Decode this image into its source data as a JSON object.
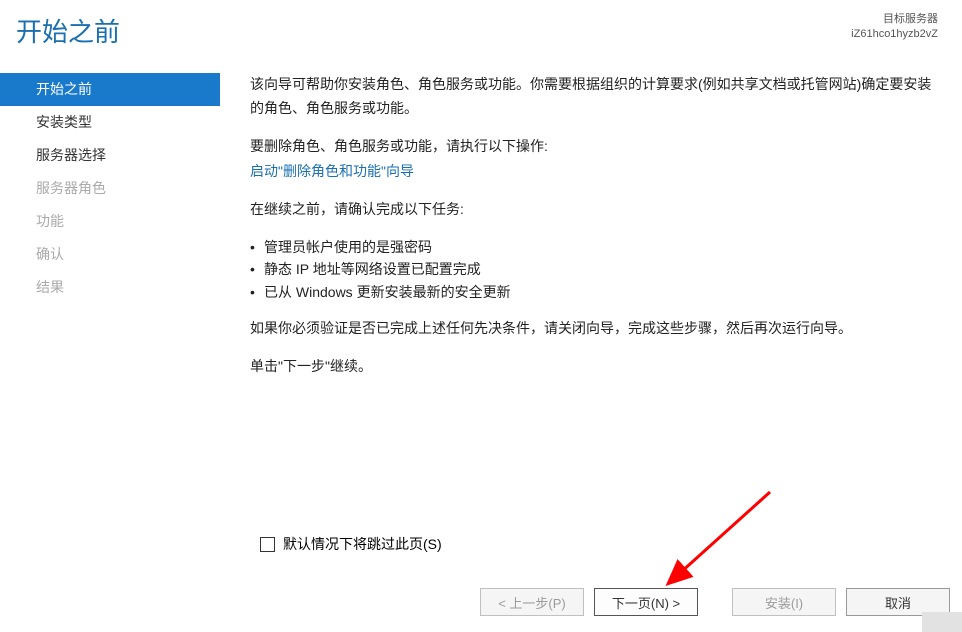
{
  "header": {
    "title": "开始之前",
    "server_label": "目标服务器",
    "server_name": "iZ61hco1hyzb2vZ"
  },
  "sidebar": {
    "items": [
      {
        "label": "开始之前",
        "state": "active"
      },
      {
        "label": "安装类型",
        "state": "normal"
      },
      {
        "label": "服务器选择",
        "state": "normal"
      },
      {
        "label": "服务器角色",
        "state": "disabled"
      },
      {
        "label": "功能",
        "state": "disabled"
      },
      {
        "label": "确认",
        "state": "disabled"
      },
      {
        "label": "结果",
        "state": "disabled"
      }
    ]
  },
  "content": {
    "intro": "该向导可帮助你安装角色、角色服务或功能。你需要根据组织的计算要求(例如共享文档或托管网站)确定要安装的角色、角色服务或功能。",
    "remove_prompt": "要删除角色、角色服务或功能，请执行以下操作:",
    "remove_link": "启动\"删除角色和功能\"向导",
    "before_continue": "在继续之前，请确认完成以下任务:",
    "bullets": [
      "管理员帐户使用的是强密码",
      "静态 IP 地址等网络设置已配置完成",
      "已从 Windows 更新安装最新的安全更新"
    ],
    "verify_note": "如果你必须验证是否已完成上述任何先决条件，请关闭向导，完成这些步骤，然后再次运行向导。",
    "click_next": "单击\"下一步\"继续。",
    "skip_label": "默认情况下将跳过此页(S)"
  },
  "footer": {
    "prev": "< 上一步(P)",
    "next": "下一页(N) >",
    "install": "安装(I)",
    "cancel": "取消"
  }
}
